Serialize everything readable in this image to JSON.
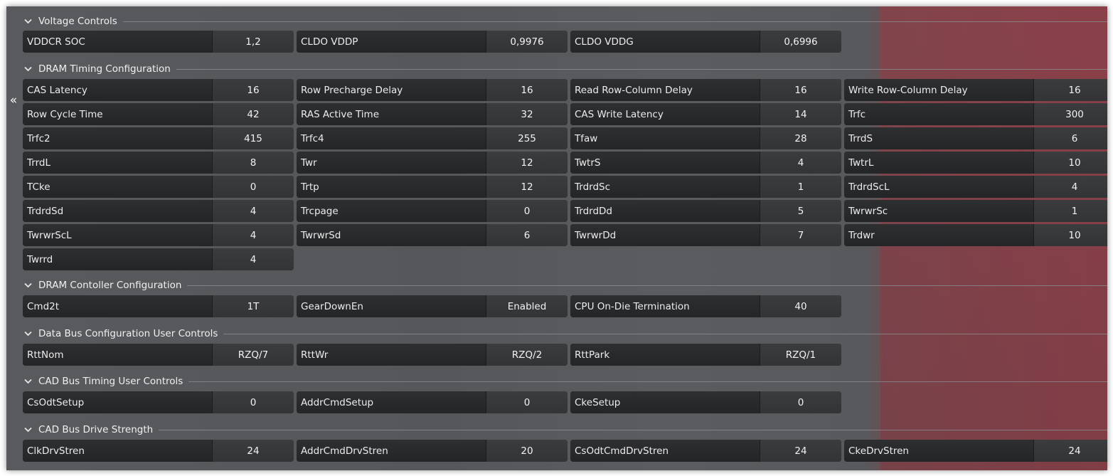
{
  "collapse_glyph": "«",
  "sections": [
    {
      "title": "Voltage Controls",
      "fields": [
        {
          "label": "VDDCR SOC",
          "value": "1,2"
        },
        {
          "label": "CLDO VDDP",
          "value": "0,9976"
        },
        {
          "label": "CLDO VDDG",
          "value": "0,6996"
        }
      ]
    },
    {
      "title": "DRAM Timing Configuration",
      "fields": [
        {
          "label": "CAS Latency",
          "value": "16"
        },
        {
          "label": "Row Precharge Delay",
          "value": "16"
        },
        {
          "label": "Read Row-Column Delay",
          "value": "16"
        },
        {
          "label": "Write Row-Column Delay",
          "value": "16"
        },
        {
          "label": "Row Cycle Time",
          "value": "42"
        },
        {
          "label": "RAS Active Time",
          "value": "32"
        },
        {
          "label": "CAS Write Latency",
          "value": "14"
        },
        {
          "label": "Trfc",
          "value": "300"
        },
        {
          "label": "Trfc2",
          "value": "415"
        },
        {
          "label": "Trfc4",
          "value": "255"
        },
        {
          "label": "Tfaw",
          "value": "28"
        },
        {
          "label": "TrrdS",
          "value": "6"
        },
        {
          "label": "TrrdL",
          "value": "8"
        },
        {
          "label": "Twr",
          "value": "12"
        },
        {
          "label": "TwtrS",
          "value": "4"
        },
        {
          "label": "TwtrL",
          "value": "10"
        },
        {
          "label": "TCke",
          "value": "0"
        },
        {
          "label": "Trtp",
          "value": "12"
        },
        {
          "label": "TrdrdSc",
          "value": "1"
        },
        {
          "label": "TrdrdScL",
          "value": "4"
        },
        {
          "label": "TrdrdSd",
          "value": "4"
        },
        {
          "label": "Trcpage",
          "value": "0"
        },
        {
          "label": "TrdrdDd",
          "value": "5"
        },
        {
          "label": "TwrwrSc",
          "value": "1"
        },
        {
          "label": "TwrwrScL",
          "value": "4"
        },
        {
          "label": "TwrwrSd",
          "value": "6"
        },
        {
          "label": "TwrwrDd",
          "value": "7"
        },
        {
          "label": "Trdwr",
          "value": "10"
        },
        {
          "label": "Twrrd",
          "value": "4"
        }
      ]
    },
    {
      "title": "DRAM Contoller Configuration",
      "fields": [
        {
          "label": "Cmd2t",
          "value": "1T"
        },
        {
          "label": "GearDownEn",
          "value": "Enabled"
        },
        {
          "label": "CPU On-Die Termination",
          "value": "40"
        }
      ]
    },
    {
      "title": "Data Bus Configuration User Controls",
      "fields": [
        {
          "label": "RttNom",
          "value": "RZQ/7"
        },
        {
          "label": "RttWr",
          "value": "RZQ/2"
        },
        {
          "label": "RttPark",
          "value": "RZQ/1"
        }
      ]
    },
    {
      "title": "CAD Bus Timing User Controls",
      "fields": [
        {
          "label": "CsOdtSetup",
          "value": "0"
        },
        {
          "label": "AddrCmdSetup",
          "value": "0"
        },
        {
          "label": "CkeSetup",
          "value": "0"
        }
      ]
    },
    {
      "title": "CAD Bus Drive Strength",
      "fields": [
        {
          "label": "ClkDrvStren",
          "value": "24"
        },
        {
          "label": "AddrCmdDrvStren",
          "value": "20"
        },
        {
          "label": "CsOdtCmdDrvStren",
          "value": "24"
        },
        {
          "label": "CkeDrvStren",
          "value": "24"
        }
      ]
    }
  ]
}
